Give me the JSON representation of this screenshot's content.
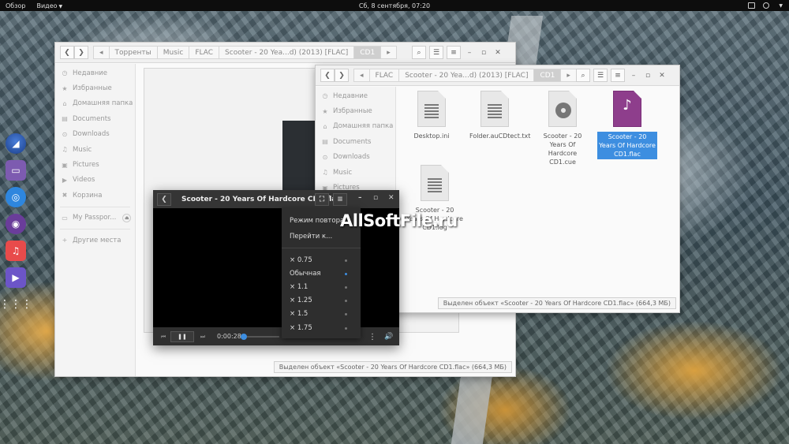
{
  "topbar": {
    "activities": "Обзор",
    "app_menu": "Видео",
    "clock": "Сб, 8 сентября, 07:20"
  },
  "dock": {
    "apps": [
      "web-browser",
      "files",
      "chromium",
      "tor",
      "music",
      "videos",
      "show-apps"
    ]
  },
  "window_back": {
    "breadcrumbs": [
      "Торренты",
      "Music",
      "FLAC",
      "Scooter - 20 Yea...d) (2013) [FLAC]",
      "CD1"
    ],
    "sidebar": [
      {
        "icon": "clock-icon",
        "label": "Недавние"
      },
      {
        "icon": "star-icon",
        "label": "Избранные"
      },
      {
        "icon": "home-icon",
        "label": "Домашняя папка"
      },
      {
        "icon": "document-icon",
        "label": "Documents"
      },
      {
        "icon": "download-icon",
        "label": "Downloads"
      },
      {
        "icon": "music-icon",
        "label": "Music"
      },
      {
        "icon": "picture-icon",
        "label": "Pictures"
      },
      {
        "icon": "video-icon",
        "label": "Videos"
      },
      {
        "icon": "trash-icon",
        "label": "Корзина"
      },
      {
        "icon": "drive-icon",
        "label": "My Passpor..."
      },
      {
        "icon": "plus-icon",
        "label": "Другие места"
      }
    ],
    "status": "Выделен объект «Scooter - 20 Years Of Hardcore CD1.flac» (664,3 МБ)"
  },
  "window_front": {
    "breadcrumbs": [
      "FLAC",
      "Scooter - 20 Yea...d) (2013) [FLAC]",
      "CD1"
    ],
    "sidebar": [
      {
        "icon": "clock-icon",
        "label": "Недавние"
      },
      {
        "icon": "star-icon",
        "label": "Избранные"
      },
      {
        "icon": "home-icon",
        "label": "Домашняя папка"
      },
      {
        "icon": "document-icon",
        "label": "Documents"
      },
      {
        "icon": "download-icon",
        "label": "Downloads"
      },
      {
        "icon": "music-icon",
        "label": "Music"
      },
      {
        "icon": "picture-icon",
        "label": "Pictures"
      }
    ],
    "files": [
      {
        "name": "Desktop.ini",
        "type": "text"
      },
      {
        "name": "Folder.auCDtect.txt",
        "type": "text"
      },
      {
        "name": "Scooter - 20 Years Of Hardcore CD1.cue",
        "type": "disc"
      },
      {
        "name": "Scooter - 20 Years Of Hardcore CD1.flac",
        "type": "music",
        "selected": true
      },
      {
        "name": "Scooter - 20 Years Of Hardcore CD1.log",
        "type": "text"
      }
    ],
    "status": "Выделен объект «Scooter - 20 Years Of Hardcore CD1.flac» (664,3 МБ)"
  },
  "player": {
    "title": "Scooter - 20 Years Of Hardcore CD1.flac",
    "time": "0:00:28"
  },
  "menu": {
    "items": [
      "Режим повтора",
      "Перейти к..."
    ],
    "speeds": [
      {
        "label": "× 0.75",
        "active": false
      },
      {
        "label": "Обычная",
        "active": true
      },
      {
        "label": "× 1.1",
        "active": false
      },
      {
        "label": "× 1.25",
        "active": false
      },
      {
        "label": "× 1.5",
        "active": false
      },
      {
        "label": "× 1.75",
        "active": false
      }
    ]
  },
  "watermark": "AllSoftFile.ru"
}
